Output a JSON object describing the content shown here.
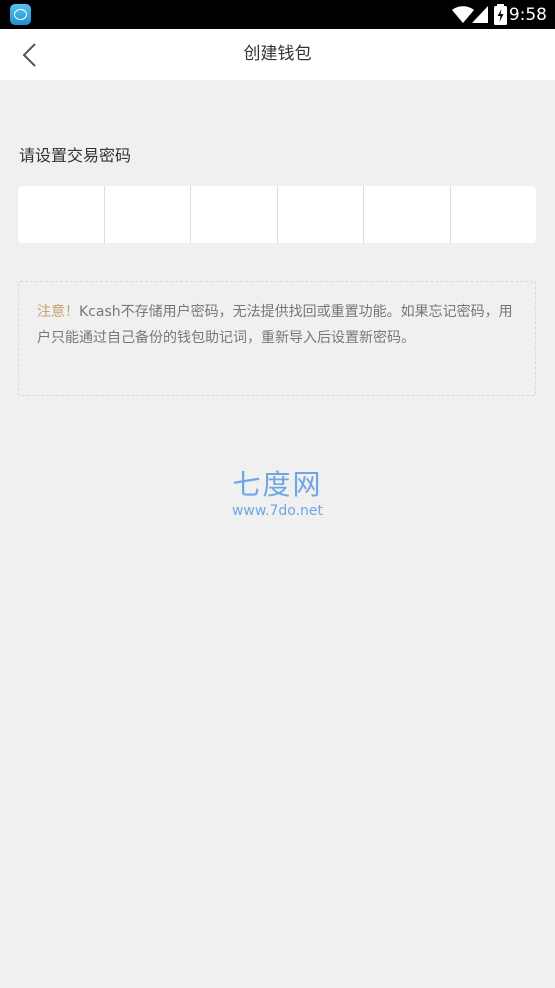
{
  "status_bar": {
    "time": "9:58",
    "app_icon": "app-badge-icon",
    "wifi_icon": "wifi-icon",
    "signal_icon": "cellular-signal-icon",
    "battery_icon": "battery-charging-icon"
  },
  "nav": {
    "back_icon": "chevron-left-icon",
    "title": "创建钱包"
  },
  "password": {
    "label": "请设置交易密码",
    "digits": [
      "",
      "",
      "",
      "",
      "",
      ""
    ]
  },
  "notice": {
    "label": "注意！",
    "text": "Kcash不存储用户密码，无法提供找回或重置功能。如果忘记密码，用户只能通过自己备份的钱包助记词，重新导入后设置新密码。"
  },
  "watermark": {
    "title": "七度网",
    "url": "www.7do.net"
  },
  "colors": {
    "background": "#f0f0f0",
    "notice_accent": "#c4a46a",
    "watermark": "#6ea6e6"
  }
}
